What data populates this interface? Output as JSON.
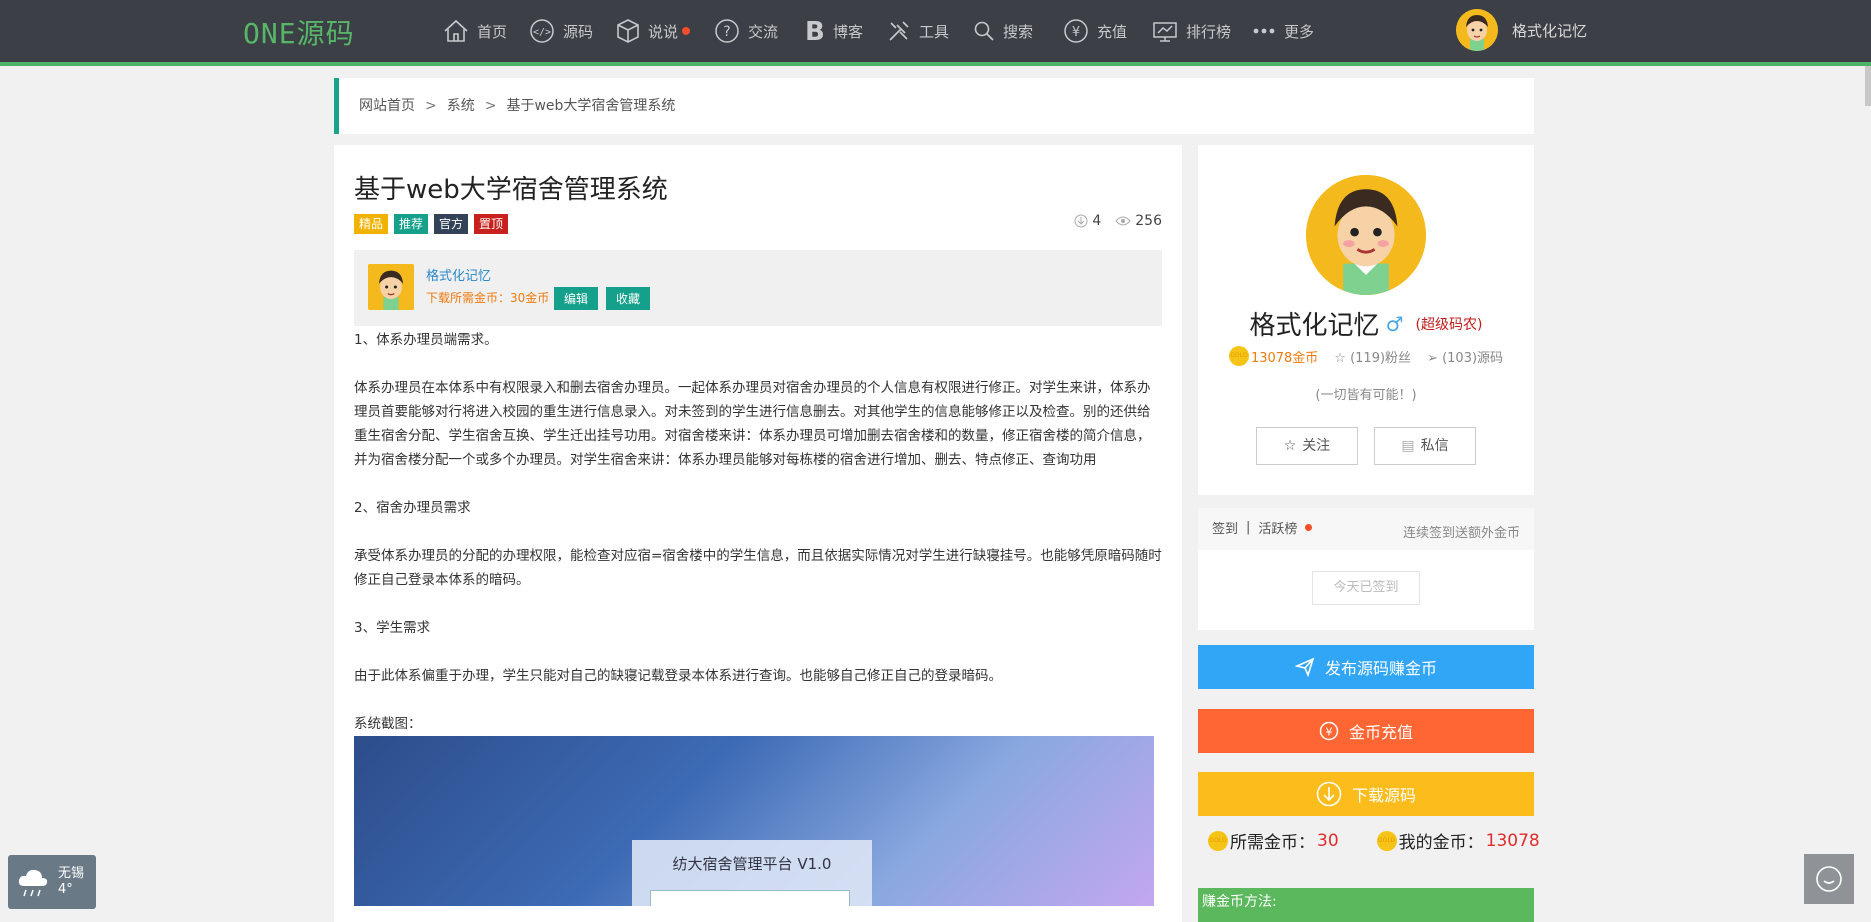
{
  "header": {
    "logo": "ONE源码",
    "nav": [
      {
        "label": "首页",
        "icon": "home-icon"
      },
      {
        "label": "源码",
        "icon": "code-icon"
      },
      {
        "label": "说说",
        "icon": "cube-icon"
      },
      {
        "label": "交流",
        "icon": "question-icon"
      },
      {
        "label": "博客",
        "icon": "blog-b-icon"
      },
      {
        "label": "工具",
        "icon": "tools-icon"
      },
      {
        "label": "搜索",
        "icon": "search-icon"
      },
      {
        "label": "充值",
        "icon": "yen-icon"
      },
      {
        "label": "排行榜",
        "icon": "ranking-icon"
      },
      {
        "label": "更多",
        "icon": "more-dots-icon"
      }
    ],
    "user": "格式化记忆"
  },
  "breadcrumb": {
    "home": "网站首页",
    "category": "系统",
    "current": "基于web大学宿舍管理系统",
    "separator": ">"
  },
  "article": {
    "title": "基于web大学宿舍管理系统",
    "tags": [
      {
        "label": "精品",
        "color": "#f2b200"
      },
      {
        "label": "推荐",
        "color": "#14a08a"
      },
      {
        "label": "官方",
        "color": "#334357"
      },
      {
        "label": "置顶",
        "color": "#c8201c"
      }
    ],
    "downloads": "4",
    "views": "256",
    "author": "格式化记忆",
    "cost_text": "下载所需金币：30金币",
    "edit_label": "编辑",
    "fav_label": "收藏",
    "paragraphs": [
      "1、体系办理员端需求。",
      "体系办理员在本体系中有权限录入和删去宿舍办理员。一起体系办理员对宿舍办理员的个人信息有权限进行修正。对学生来讲，体系办理员首要能够对行将进入校园的重生进行信息录入。对未签到的学生进行信息删去。对其他学生的信息能够修正以及检查。别的还供给重生宿舍分配、学生宿舍互换、学生迁出挂号功用。对宿舍楼来讲：体系办理员可增加删去宿舍楼和的数量，修正宿舍楼的简介信息，并为宿舍楼分配一个或多个办理员。对学生宿舍来讲：体系办理员能够对每栋楼的宿舍进行增加、删去、特点修正、查询功用",
      "2、宿舍办理员需求",
      "承受体系办理员的分配的办理权限，能检查对应宿=宿舍楼中的学生信息，而且依据实际情况对学生进行缺寝挂号。也能够凭原暗码随时修正自己登录本体系的暗码。",
      "3、学生需求",
      "由于此体系偏重于办理，学生只能对自己的缺寝记载登录本体系进行查询。也能够自己修正自己的登录暗码。",
      "系统截图："
    ],
    "screenshot_title": "纺大宿舍管理平台 V1.0"
  },
  "profile": {
    "name": "格式化记忆",
    "gender": "♂",
    "rank": "(超级码农)",
    "gold": "13078金币",
    "fans": "(119)粉丝",
    "sources": "(103)源码",
    "motto": "(一切皆有可能！)",
    "follow_label": "关注",
    "message_label": "私信"
  },
  "signin": {
    "tab1": "签到",
    "divider": "|",
    "tab2": "活跃榜",
    "note": "连续签到送额外金币",
    "button": "今天已签到"
  },
  "actions": {
    "publish": "发布源码赚金币",
    "recharge": "金币充值",
    "download": "下载源码"
  },
  "coins": {
    "need_label": "所需金币：",
    "need_value": "30",
    "mine_label": "我的金币：",
    "mine_value": "13078"
  },
  "earn_title": "赚金币方法:",
  "weather": {
    "city": "无锡",
    "temp": "4°"
  },
  "colors": {
    "topbar": "#3c3f45",
    "accent": "#4cb464",
    "publish": "#31a6f7",
    "recharge": "#ff6633",
    "download": "#fcbc1b"
  }
}
